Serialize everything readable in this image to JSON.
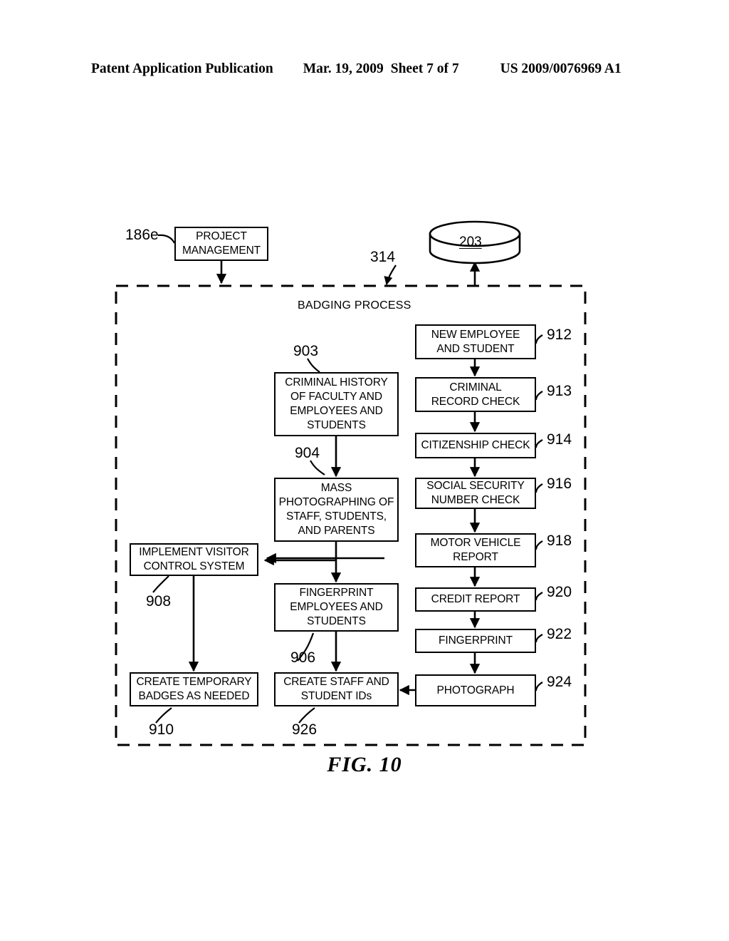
{
  "header": {
    "publication": "Patent Application Publication",
    "date": "Mar. 19, 2009",
    "sheet": "Sheet 7 of 7",
    "patent_number": "US 2009/0076969 A1"
  },
  "figure": {
    "caption": "FIG. 10",
    "container_label": "BADGING PROCESS",
    "container_ref": "314",
    "database_label": "203"
  },
  "nodes": {
    "project_management": {
      "label": "PROJECT MANAGEMENT",
      "ref": "186e"
    },
    "criminal_history": {
      "label": "CRIMINAL HISTORY OF FACULTY AND EMPLOYEES AND STUDENTS",
      "ref": "903"
    },
    "mass_photographing": {
      "label": "MASS PHOTOGRAPHING OF STAFF, STUDENTS, AND PARENTS",
      "ref": "904"
    },
    "fingerprint_emp": {
      "label": "FINGERPRINT EMPLOYEES AND STUDENTS",
      "ref": "906"
    },
    "visitor_control": {
      "label": "IMPLEMENT VISITOR CONTROL SYSTEM",
      "ref": "908"
    },
    "temp_badges": {
      "label": "CREATE TEMPORARY BADGES AS NEEDED",
      "ref": "910"
    },
    "staff_student_ids": {
      "label": "CREATE STAFF AND STUDENT IDs",
      "ref": "926"
    },
    "new_employee": {
      "label": "NEW EMPLOYEE AND STUDENT",
      "ref": "912"
    },
    "criminal_record": {
      "label": "CRIMINAL RECORD CHECK",
      "ref": "913"
    },
    "citizenship": {
      "label": "CITIZENSHIP CHECK",
      "ref": "914"
    },
    "ssn_check": {
      "label": "SOCIAL SECURITY NUMBER CHECK",
      "ref": "916"
    },
    "motor_vehicle": {
      "label": "MOTOR VEHICLE REPORT",
      "ref": "918"
    },
    "credit_report": {
      "label": "CREDIT REPORT",
      "ref": "920"
    },
    "fingerprint": {
      "label": "FINGERPRINT",
      "ref": "922"
    },
    "photograph": {
      "label": "PHOTOGRAPH",
      "ref": "924"
    }
  },
  "node_lines": {
    "project_management": [
      "PROJECT",
      "MANAGEMENT"
    ],
    "criminal_history": [
      "CRIMINAL HISTORY",
      "OF FACULTY AND",
      "EMPLOYEES AND",
      "STUDENTS"
    ],
    "mass_photographing": [
      "MASS",
      "PHOTOGRAPHING OF",
      "STAFF, STUDENTS,",
      "AND PARENTS"
    ],
    "fingerprint_emp": [
      "FINGERPRINT",
      "EMPLOYEES AND",
      "STUDENTS"
    ],
    "visitor_control": [
      "IMPLEMENT VISITOR",
      "CONTROL SYSTEM"
    ],
    "temp_badges": [
      "CREATE TEMPORARY",
      "BADGES AS NEEDED"
    ],
    "staff_student_ids": [
      "CREATE STAFF AND",
      "STUDENT IDs"
    ],
    "new_employee": [
      "NEW EMPLOYEE",
      "AND STUDENT"
    ],
    "criminal_record": [
      "CRIMINAL",
      "RECORD CHECK"
    ],
    "citizenship": [
      "CITIZENSHIP CHECK"
    ],
    "ssn_check": [
      "SOCIAL SECURITY",
      "NUMBER CHECK"
    ],
    "motor_vehicle": [
      "MOTOR VEHICLE",
      "REPORT"
    ],
    "credit_report": [
      "CREDIT REPORT"
    ],
    "fingerprint": [
      "FINGERPRINT"
    ],
    "photograph": [
      "PHOTOGRAPH"
    ]
  },
  "colors": {
    "ink": "#000000",
    "paper": "#ffffff"
  }
}
